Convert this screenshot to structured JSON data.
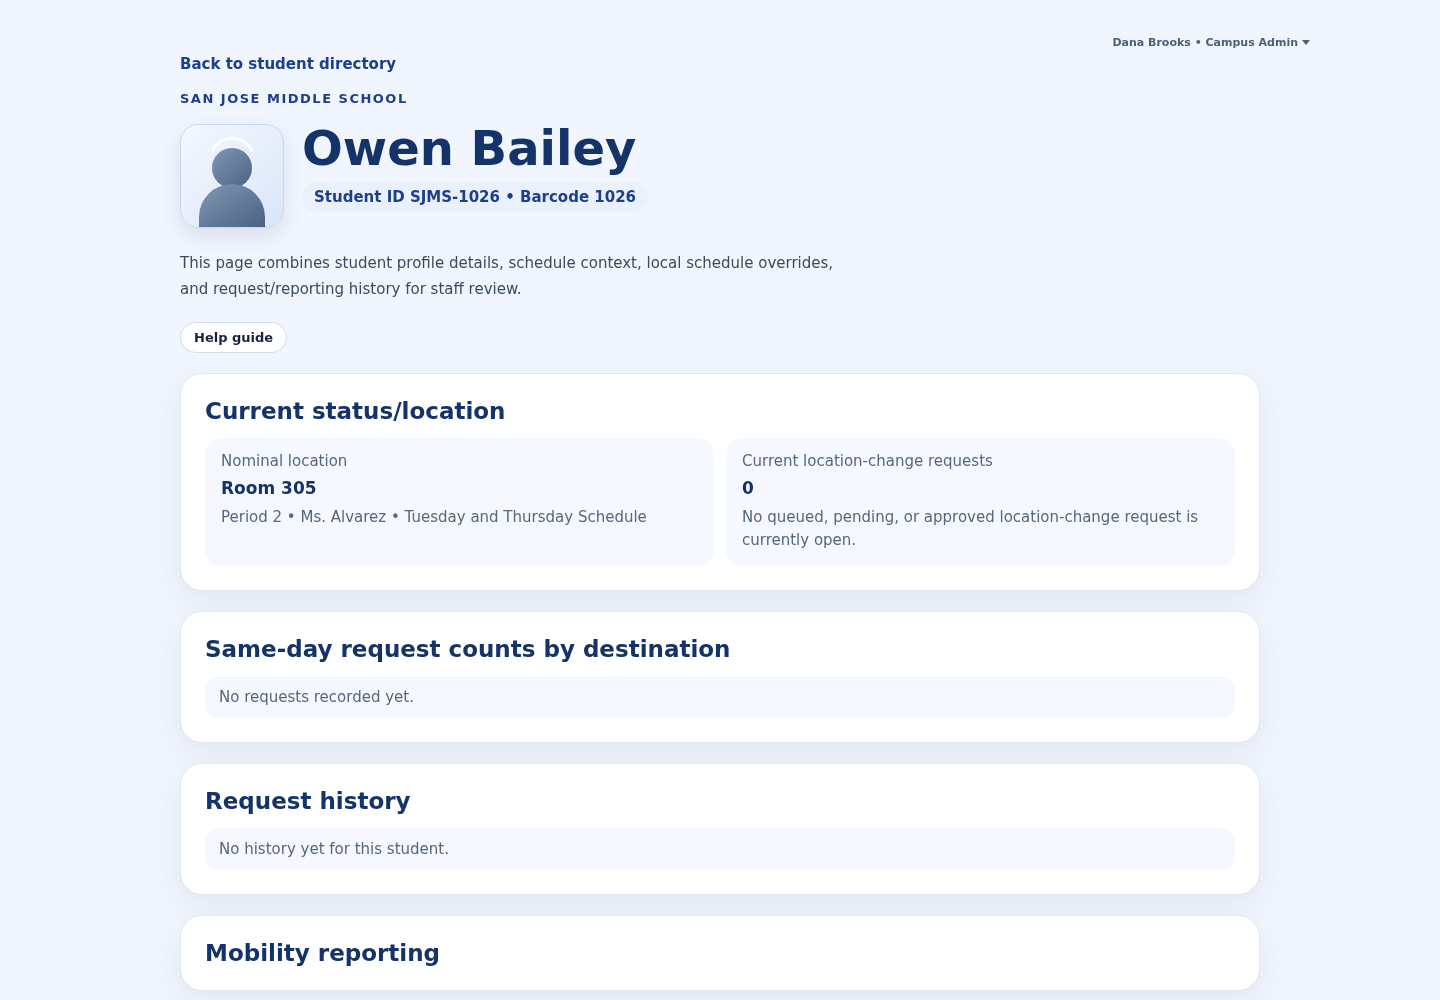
{
  "user_menu": {
    "label": "Dana Brooks • Campus Admin"
  },
  "back_link": "Back to student directory",
  "school": "SAN JOSE MIDDLE SCHOOL",
  "student": {
    "name": "Owen Bailey",
    "ids": "Student ID SJMS-1026 • Barcode 1026"
  },
  "intro": "This page combines student profile details, schedule context, local schedule overrides, and request/reporting history for staff review.",
  "help_button": "Help guide",
  "sections": [
    {
      "kind": "status",
      "title": "Current status/location",
      "tiles": [
        {
          "label": "Nominal location",
          "value": "Room 305",
          "detail": "Period 2 • Ms. Alvarez • Tuesday and Thursday Schedule"
        },
        {
          "label": "Current location-change requests",
          "value": "0",
          "detail": "No queued, pending, or approved location-change request is currently open."
        }
      ]
    },
    {
      "kind": "empty",
      "title": "Same-day request counts by destination",
      "message": "No requests recorded yet."
    },
    {
      "kind": "empty",
      "title": "Request history",
      "message": "No history yet for this student."
    },
    {
      "kind": "heading",
      "title": "Mobility reporting"
    }
  ]
}
